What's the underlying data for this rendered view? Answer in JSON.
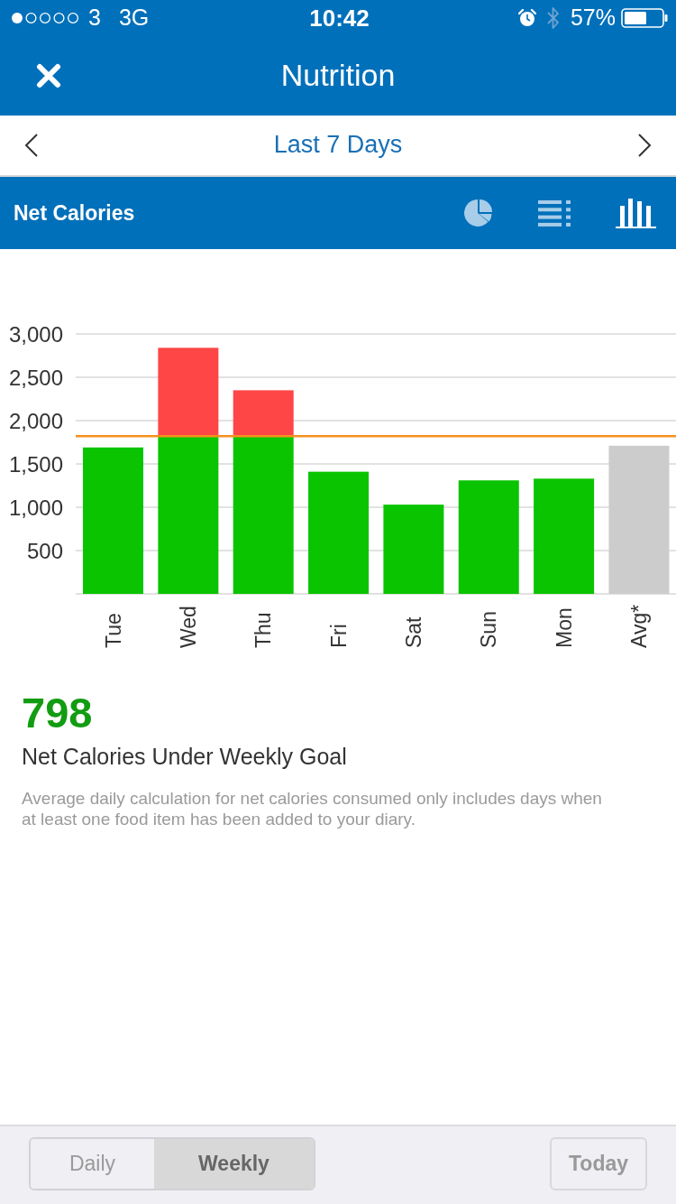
{
  "status_bar": {
    "carrier": "3",
    "network": "3G",
    "time": "10:42",
    "battery": "57%"
  },
  "nav": {
    "title": "Nutrition"
  },
  "date_range": {
    "label": "Last 7 Days"
  },
  "section": {
    "title": "Net Calories",
    "views": [
      {
        "kind": "pie",
        "selected": false
      },
      {
        "kind": "list",
        "selected": false
      },
      {
        "kind": "bar",
        "selected": true
      }
    ]
  },
  "chart": {
    "chart_data": {
      "type": "bar",
      "categories": [
        "Tue",
        "Wed",
        "Thu",
        "Fri",
        "Sat",
        "Sun",
        "Mon",
        "Avg*"
      ],
      "series": [
        {
          "color": "#0ac400",
          "values": [
            1690,
            1820,
            1820,
            1410,
            1030,
            1310,
            1330,
            null
          ]
        },
        {
          "color": "#ff4646",
          "values": [
            null,
            1020,
            530,
            null,
            null,
            null,
            null,
            null
          ]
        },
        {
          "color": "#cccccc",
          "values": [
            null,
            null,
            null,
            null,
            null,
            null,
            null,
            1710
          ]
        }
      ],
      "stacked": true,
      "grid": true,
      "ylim": [
        0,
        3000
      ],
      "yticks": [
        500,
        {
          "value": 1000,
          "label": "1,000"
        },
        {
          "value": 1500,
          "label": "1,500"
        },
        {
          "value": 2000,
          "label": "2,000"
        },
        {
          "value": 2500,
          "label": "2,500"
        },
        {
          "value": 3000,
          "label": "3,000"
        }
      ],
      "ref_lines": [
        {
          "axis": "y",
          "value": 1820,
          "color": "#f7901e"
        }
      ]
    }
  },
  "summary": {
    "value": "798",
    "label": "Net Calories Under Weekly Goal",
    "note": "Average daily calculation for net calories consumed only includes days when at least one food item has been added to your diary."
  },
  "toolbar": {
    "periods": [
      {
        "label": "Daily",
        "selected": false
      },
      {
        "label": "Weekly",
        "selected": true
      }
    ],
    "today": "Today"
  }
}
